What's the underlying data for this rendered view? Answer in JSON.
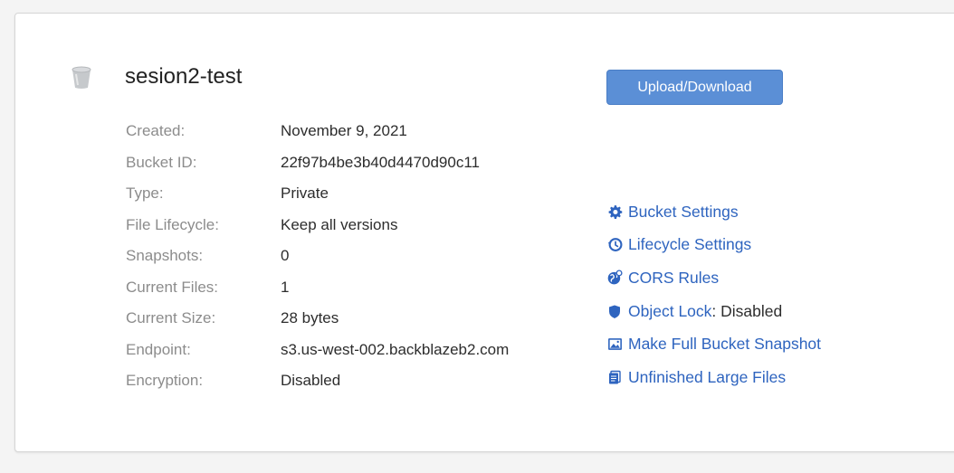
{
  "bucket": {
    "name": "sesion2-test",
    "icon": "bucket-icon"
  },
  "details": [
    {
      "label": "Created:",
      "value": "November 9, 2021"
    },
    {
      "label": "Bucket ID:",
      "value": "22f97b4be3b40d4470d90c11"
    },
    {
      "label": "Type:",
      "value": "Private"
    },
    {
      "label": "File Lifecycle:",
      "value": "Keep all versions"
    },
    {
      "label": "Snapshots:",
      "value": "0"
    },
    {
      "label": "Current Files:",
      "value": "1"
    },
    {
      "label": "Current Size:",
      "value": "28 bytes"
    },
    {
      "label": "Endpoint:",
      "value": "s3.us-west-002.backblazeb2.com"
    },
    {
      "label": "Encryption:",
      "value": "Disabled"
    }
  ],
  "actions": {
    "upload_label": "Upload/Download"
  },
  "links": [
    {
      "label": "Bucket Settings",
      "suffix": "",
      "icon": "gear-icon"
    },
    {
      "label": "Lifecycle Settings",
      "suffix": "",
      "icon": "history-icon"
    },
    {
      "label": "CORS Rules",
      "suffix": "",
      "icon": "globe-icon"
    },
    {
      "label": "Object Lock",
      "suffix": ": Disabled",
      "icon": "shield-icon"
    },
    {
      "label": "Make Full Bucket Snapshot",
      "suffix": "",
      "icon": "image-icon"
    },
    {
      "label": "Unfinished Large Files",
      "suffix": "",
      "icon": "document-icon"
    }
  ],
  "colors": {
    "link": "#2e64bf",
    "button": "#5b8fd6",
    "label": "#8c8c8c",
    "value": "#2d2d2d"
  }
}
